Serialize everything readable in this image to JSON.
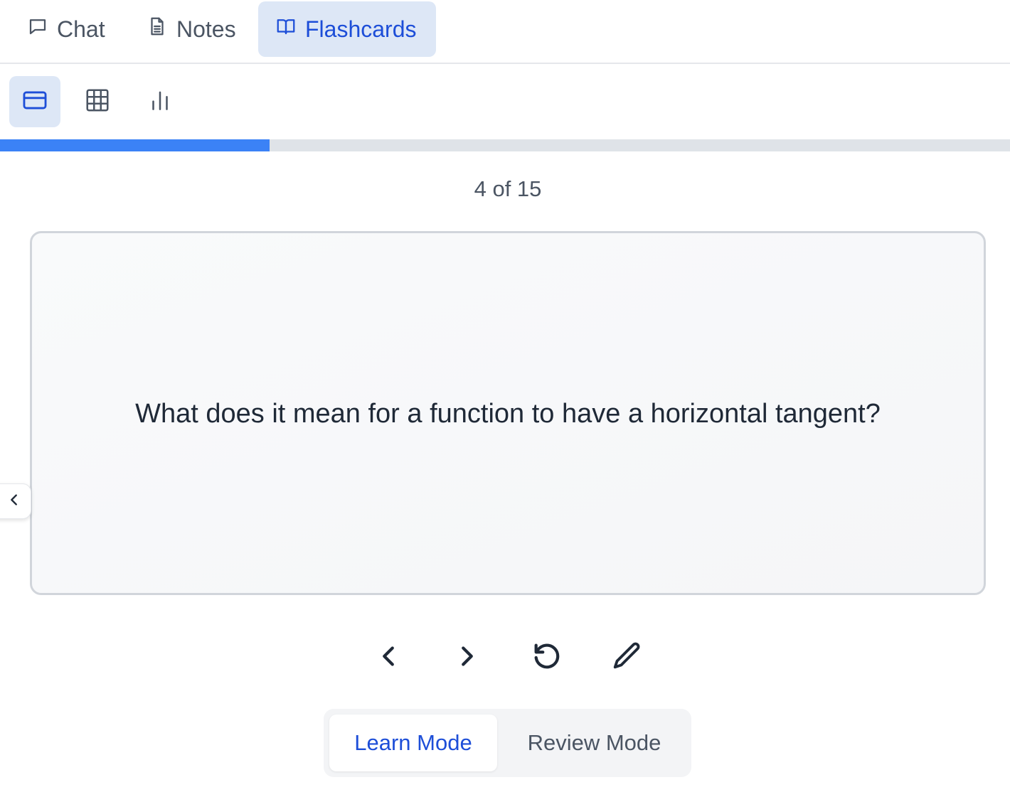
{
  "tabs": {
    "chat": "Chat",
    "notes": "Notes",
    "flashcards": "Flashcards",
    "active": "flashcards"
  },
  "views": [
    {
      "icon": "card-icon",
      "active": true
    },
    {
      "icon": "grid-icon",
      "active": false
    },
    {
      "icon": "bar-chart-icon",
      "active": false
    }
  ],
  "progress": {
    "current": 4,
    "total": 15,
    "label": "4 of 15",
    "fraction": 0.267
  },
  "card": {
    "question": "What does it mean for a function to have a horizontal tangent?"
  },
  "controls": [
    "chevron-left-icon",
    "chevron-right-icon",
    "rotate-ccw-icon",
    "pencil-icon"
  ],
  "modes": {
    "learn": "Learn Mode",
    "review": "Review Mode",
    "active": "learn"
  },
  "colors": {
    "accent": "#1d4ed8",
    "progress": "#3b82f6",
    "active_bg": "#dde7f6"
  }
}
